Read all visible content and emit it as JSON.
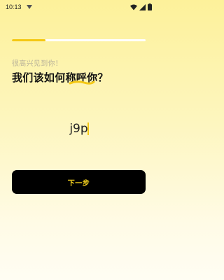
{
  "status_bar": {
    "time": "10:13",
    "icons": [
      "notification-icon",
      "wifi-icon",
      "signal-icon",
      "battery-icon"
    ]
  },
  "progress": {
    "value": 0.25,
    "fill_color": "#f4c814",
    "track_color": "#ffffff"
  },
  "greeting": "很高兴见到你！",
  "question": "我们该如何称呼你？",
  "name_input": {
    "value": "j9p",
    "placeholder": ""
  },
  "next_button": {
    "label": "下一步",
    "bg_color": "#000000",
    "text_color": "#f6d21f"
  },
  "accent_color": "#f4c814"
}
